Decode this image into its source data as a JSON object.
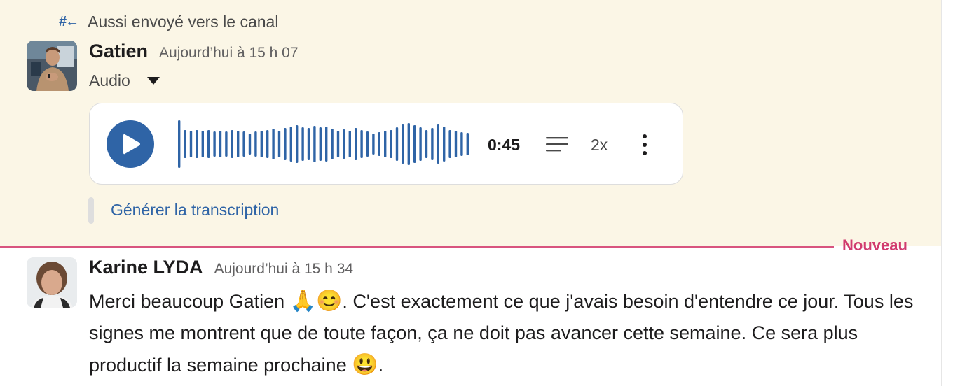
{
  "first_message": {
    "shared_icon": "#←",
    "shared_label": "Aussi envoyé vers le canal",
    "author": "Gatien",
    "timestamp": "Aujourd’hui à 15 h 07",
    "attachment_label": "Audio",
    "audio": {
      "duration": "0:45",
      "speed": "2x",
      "play_icon": "play-icon",
      "transcript_icon": "lines-icon",
      "more_icon": "vertical-ellipsis-icon"
    },
    "transcribe_link": "Générer la transcription"
  },
  "divider": {
    "label": "Nouveau"
  },
  "second_message": {
    "author": "Karine LYDA",
    "timestamp": "Aujourd’hui à 15 h 34",
    "text_part1": "Merci beaucoup Gatien ",
    "emoji_pray": "🙏",
    "emoji_smile": "😊",
    "text_part2": ". C'est exactement ce que j'avais besoin d'entendre ce jour. Tous les signes me montrent que de toute façon, ça ne doit pas avancer cette semaine. Ce sera plus productif la semaine prochaine ",
    "emoji_grin": "😃",
    "text_part3": "."
  },
  "colors": {
    "highlight_bg": "#fbf6e6",
    "accent_blue": "#2f64a6",
    "new_red": "#d13b6e"
  }
}
